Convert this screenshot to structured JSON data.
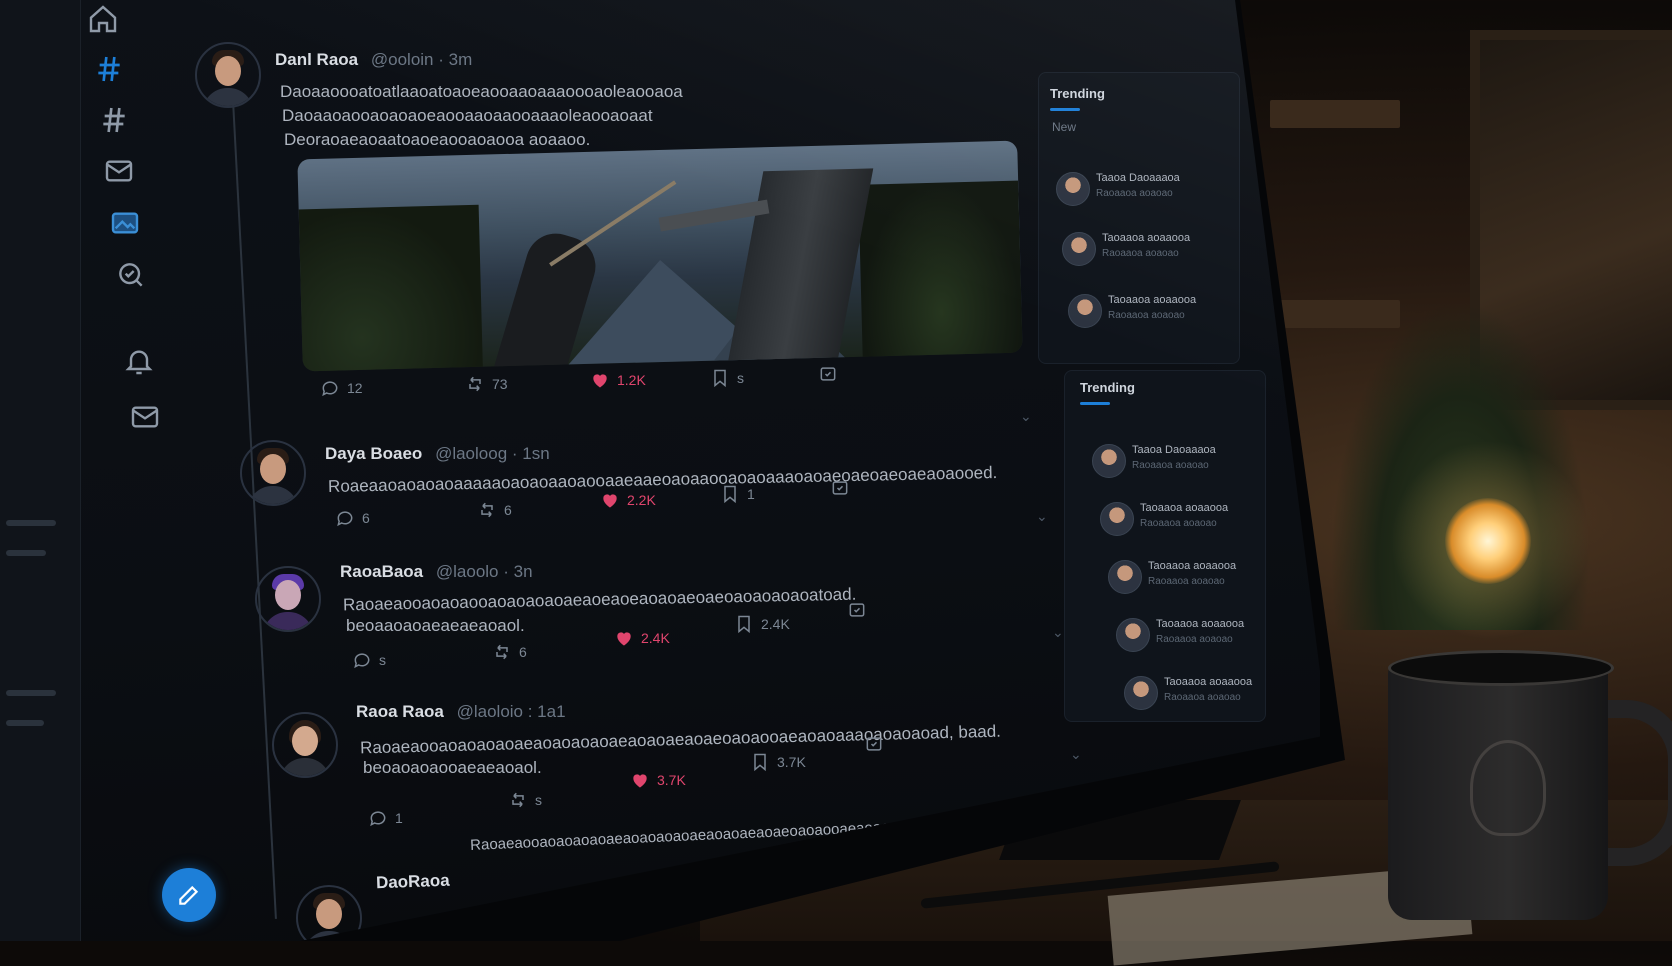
{
  "nav": {
    "items": [
      {
        "icon": "home-icon"
      },
      {
        "icon": "hashtag-icon"
      },
      {
        "icon": "hashtag-icon"
      },
      {
        "icon": "mail-icon"
      },
      {
        "icon": "media-icon"
      },
      {
        "icon": "search-icon"
      },
      {
        "icon": "bell-icon"
      },
      {
        "icon": "mail-icon"
      }
    ],
    "compose_icon": "compose-icon"
  },
  "feed": {
    "posts": [
      {
        "name": "Danl Raoa",
        "handle": "@ooloin · 3m",
        "text": [
          "Daoaaoooatoatlaaoatoaoeaooaaoaaaoooaoleaooaoa",
          "Daoaaoaooaoaoaoeaooaaoaaooaaaoleaooaoaat",
          "Deoraoaeaoaatoaoeaooaoaooa   aoaaoo."
        ],
        "replies": "12",
        "reposts": "73",
        "likes": "1.2K",
        "bookmarks": "s"
      },
      {
        "name": "Daya Boaeo",
        "handle": "@laoloog · 1sn",
        "text": [
          "Roaeaaoaoaoaoaaaaaoaoaoaaoaooaaeaaeoaoaaooaoaoaaaoaoaeoaeoaeoaeaoaooed."
        ],
        "replies": "6",
        "reposts": "6",
        "likes": "2.2K",
        "bookmarks": "1"
      },
      {
        "name": "RaoaBaoa",
        "handle": "@laoolo · 3n",
        "text": [
          "Raoaeaooaoaoaooaoaoaoaoaeaoeaoeaoaoaeoaeoaoaoaoaoatoad.",
          "beoaaoaoaeaeaeaoaol."
        ],
        "replies": "s",
        "reposts": "6",
        "likes": "2.4K",
        "bookmarks": "2.4K"
      },
      {
        "name": "Raoa Raoa",
        "handle": "@laoloio : 1a1",
        "text": [
          "Raoaeaooaoaoaoaoaeaoaoaoaoaeaoaoaeaoaeoaoaooaeaoaoaaaoaoaoaoad, baad.",
          "beoaoaoaooaeaeaoaol."
        ],
        "replies": "1",
        "reposts": "s",
        "likes": "3.7K",
        "bookmarks": "3.7K"
      },
      {
        "name": "DaoRaoa",
        "handle": "",
        "text": [
          "Raoaeaooaoaoaoaoaeaoaoaoaoaeaoaoaeaoaeoaoaooaeaoaoaaaoaoaoaoaoaod."
        ],
        "replies": "",
        "reposts": "",
        "likes": "",
        "bookmarks": ""
      }
    ]
  },
  "sidebar": {
    "panel1": {
      "title": "Trending",
      "tab": "New",
      "items": [
        {
          "line1": "Taaoa Daoaaaoa",
          "line2": "Raoaaoa aoaoao"
        },
        {
          "line1": "Taoaaoa aoaaooa",
          "line2": "Raoaaoa aoaoao"
        },
        {
          "line1": "Taoaaoa aoaaooa",
          "line2": "Raoaaoa aoaoao"
        }
      ]
    },
    "panel2": {
      "title": "Trending",
      "items": [
        {
          "line1": "Taaoa Daoaaaoa",
          "line2": "Raoaaoa aoaoao"
        },
        {
          "line1": "Taoaaoa aoaaooa",
          "line2": "Raoaaoa aoaoao"
        },
        {
          "line1": "Taoaaoa aoaaooa",
          "line2": "Raoaaoa aoaoao"
        },
        {
          "line1": "Taoaaoa aoaaooa",
          "line2": "Raoaaoa aoaoao"
        },
        {
          "line1": "Taoaaoa aoaaooa",
          "line2": "Raoaaoa aoaoao"
        }
      ]
    }
  },
  "colors": {
    "accent": "#1d7fd8",
    "like": "#e0456d",
    "screen_bg": "#0b0e13"
  }
}
